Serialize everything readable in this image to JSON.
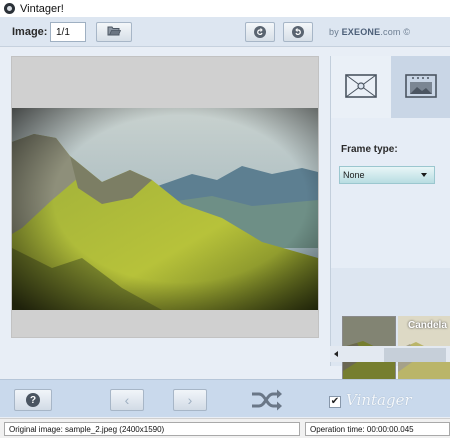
{
  "window": {
    "title": "Vintager!",
    "icon": "app-icon"
  },
  "toolbar": {
    "image_label": "Image:",
    "image_value": "1/1",
    "open_folder_icon": "folder-open-icon",
    "undo_icon": "undo-icon",
    "redo_icon": "redo-icon",
    "brand_prefix": "by ",
    "brand_name": "EXEONE",
    "brand_suffix": ".com ©"
  },
  "side_panel": {
    "tabs": [
      {
        "name": "frames",
        "icon": "frame-ornament-icon",
        "selected": false
      },
      {
        "name": "border",
        "icon": "photo-border-icon",
        "selected": true
      }
    ],
    "frame_type_label": "Frame type:",
    "frame_type_value": "None",
    "thumbnails": [
      {
        "caption": ""
      },
      {
        "caption": "Candela"
      }
    ]
  },
  "bottom_bar": {
    "help_label": "?",
    "prev_label": "‹",
    "next_label": "›",
    "shuffle_icon": "shuffle-icon",
    "vintager_checked": true,
    "vintager_check_mark": "✔",
    "vintager_label": "Vintager"
  },
  "status": {
    "original_image": "Original image: sample_2.jpeg (2400x1590)",
    "operation_time": "Operation time: 00:00:00.045"
  },
  "colors": {
    "toolbar_bg": "#dde6f1",
    "bottom_bar_bg": "#c9d9ec",
    "select_bg": "#b8dde2"
  }
}
